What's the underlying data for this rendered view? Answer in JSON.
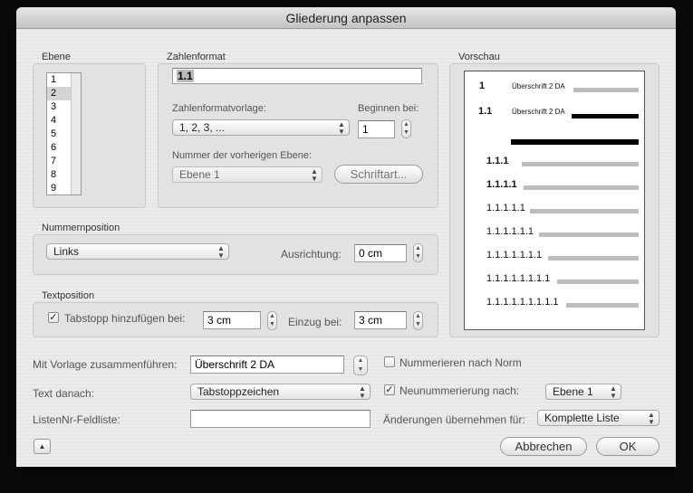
{
  "window": {
    "title": "Gliederung anpassen"
  },
  "ebene": {
    "label": "Ebene",
    "items": [
      "1",
      "2",
      "3",
      "4",
      "5",
      "6",
      "7",
      "8",
      "9"
    ],
    "selected": "2"
  },
  "zahlenformat": {
    "label": "Zahlenformat",
    "value": "1.1",
    "vorlage_label": "Zahlenformatvorlage:",
    "vorlage_value": "1, 2, 3, ...",
    "beginnen_label": "Beginnen bei:",
    "beginnen_value": "1",
    "vorherige_label": "Nummer der vorherigen Ebene:",
    "vorherige_value": "Ebene 1",
    "schriftart_button": "Schriftart..."
  },
  "vorschau": {
    "label": "Vorschau",
    "rows": [
      {
        "num": "1",
        "text": "Überschrift 2 DA"
      },
      {
        "num": "1.1",
        "text": "Überschrift 2 DA"
      },
      {
        "num": "1.1.1"
      },
      {
        "num": "1.1.1.1"
      },
      {
        "num": "1.1.1.1.1"
      },
      {
        "num": "1.1.1.1.1.1"
      },
      {
        "num": "1.1.1.1.1.1.1"
      },
      {
        "num": "1.1.1.1.1.1.1.1"
      },
      {
        "num": "1.1.1.1.1.1.1.1.1"
      }
    ]
  },
  "nummernposition": {
    "label": "Nummernposition",
    "value": "Links",
    "ausrichtung_label": "Ausrichtung:",
    "ausrichtung_value": "0 cm"
  },
  "textposition": {
    "label": "Textposition",
    "tabstopp_label": "Tabstopp hinzufügen bei:",
    "tabstopp_checked": true,
    "tabstopp_value": "3 cm",
    "einzug_label": "Einzug bei:",
    "einzug_value": "3 cm"
  },
  "bottom": {
    "vorlage_label": "Mit Vorlage zusammenführen:",
    "vorlage_value": "Überschrift 2 DA",
    "text_danach_label": "Text danach:",
    "text_danach_value": "Tabstoppzeichen",
    "listennr_label": "ListenNr-Feldliste:",
    "listennr_value": "",
    "nummerieren_label": "Nummerieren nach Norm",
    "nummerieren_checked": false,
    "neunummerierung_label": "Neunummerierung nach:",
    "neunummerierung_checked": true,
    "neunummerierung_value": "Ebene 1",
    "aenderungen_label": "Änderungen übernehmen für:",
    "aenderungen_value": "Komplette Liste"
  },
  "buttons": {
    "abbrechen": "Abbrechen",
    "ok": "OK",
    "collapse": "▲"
  },
  "icons": {
    "popup_arrows": "▲▼",
    "checkmark": "✓"
  }
}
